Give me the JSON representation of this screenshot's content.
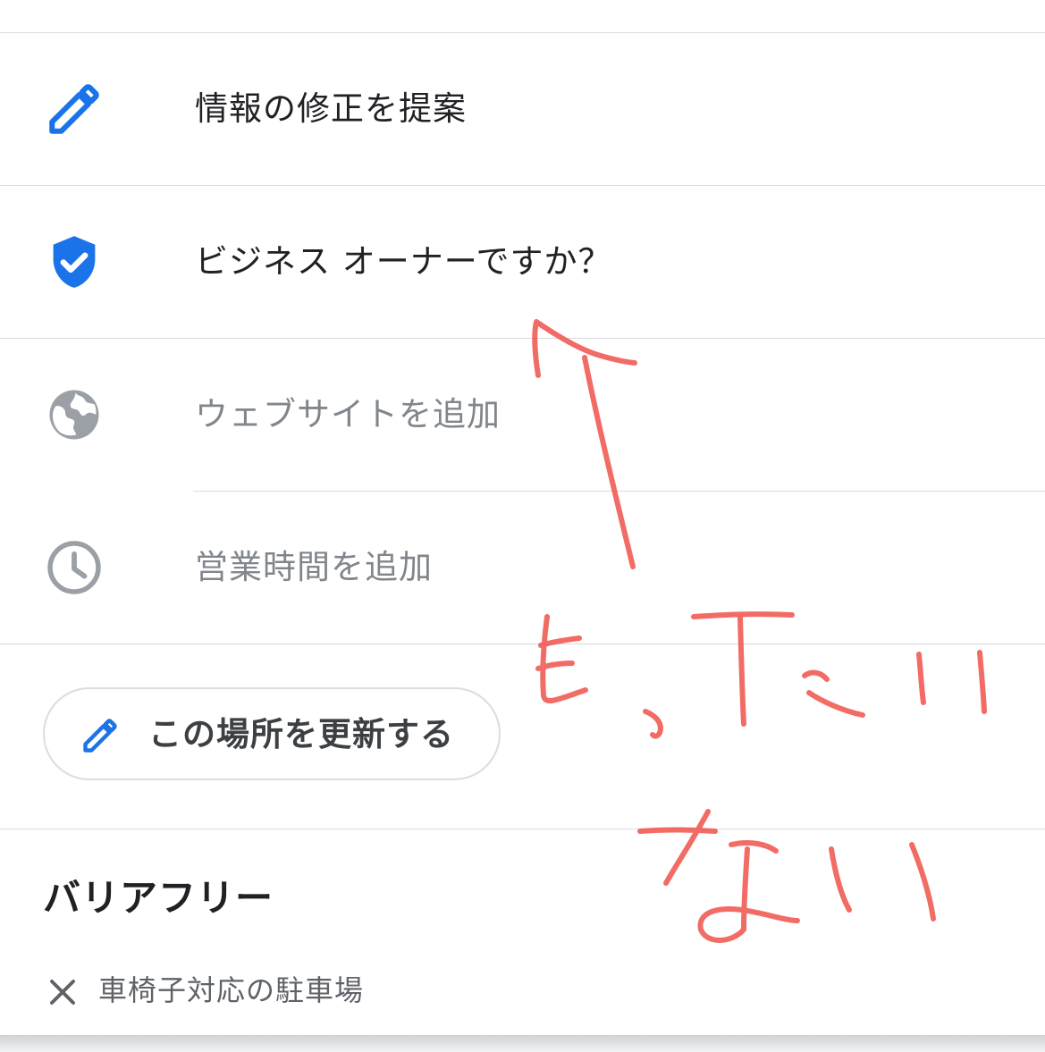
{
  "colors": {
    "accent": "#1a73e8",
    "icon_grey": "#9aa0a6",
    "text_dark": "#202124",
    "text_grey": "#80868b",
    "divider": "#dadce0",
    "annotation_red": "#f0524b"
  },
  "menu": {
    "items": [
      {
        "icon": "pencil-icon",
        "label": "情報の修正を提案"
      },
      {
        "icon": "verified-shield-icon",
        "label": "ビジネス オーナーですか？"
      },
      {
        "icon": "globe-icon",
        "label": "ウェブサイトを追加"
      },
      {
        "icon": "clock-icon",
        "label": "営業時間を追加"
      }
    ]
  },
  "update_button": {
    "icon": "pencil-icon",
    "label": "この場所を更新する"
  },
  "accessibility": {
    "title": "バリアフリー",
    "features": [
      {
        "icon": "close-icon",
        "label": "車椅子対応の駐車場"
      }
    ]
  }
}
